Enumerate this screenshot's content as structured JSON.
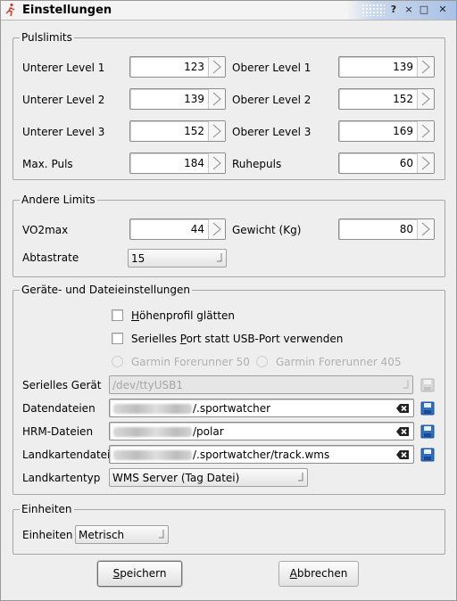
{
  "window": {
    "title": "Einstellungen",
    "buttons": {
      "help": "?",
      "minimize": "×",
      "maximize": "□",
      "close": "✕"
    }
  },
  "pulse_limits": {
    "title": "Pulslimits",
    "rows": [
      {
        "left_label": "Unterer Level 1",
        "left_value": "123",
        "right_label": "Oberer Level 1",
        "right_value": "139"
      },
      {
        "left_label": "Unterer Level 2",
        "left_value": "139",
        "right_label": "Oberer Level 2",
        "right_value": "152"
      },
      {
        "left_label": "Unterer Level 3",
        "left_value": "152",
        "right_label": "Oberer Level 3",
        "right_value": "169"
      },
      {
        "left_label": "Max. Puls",
        "left_value": "184",
        "right_label": "Ruhepuls",
        "right_value": "60"
      }
    ]
  },
  "other_limits": {
    "title": "Andere Limits",
    "vo2max_label": "VO2max",
    "vo2max_value": "44",
    "weight_label": "Gewicht (Kg)",
    "weight_value": "80",
    "sample_rate_label": "Abtastrate",
    "sample_rate_value": "15"
  },
  "device_settings": {
    "title": "Geräte- und Dateieinstellungen",
    "smooth_elevation_pre": "H",
    "smooth_elevation_rest": "öhenprofil glätten",
    "serial_port_pre": "Serielles ",
    "serial_port_key": "P",
    "serial_port_rest": "ort statt USB-Port verwenden",
    "radio_fr50": "Garmin Forerunner 50",
    "radio_fr405": "Garmin Forerunner 405",
    "serial_device_label": "Serielles Gerät",
    "serial_device_value": "/dev/ttyUSB1",
    "data_files_label": "Datendateien",
    "data_files_value": "/.sportwatcher",
    "hrm_files_label": "HRM-Dateien",
    "hrm_files_value": "/polar",
    "map_file_label": "Landkartendatei",
    "map_file_value": "/.sportwatcher/track.wms",
    "map_type_label": "Landkartentyp",
    "map_type_value": "WMS Server (Tag Datei)"
  },
  "units": {
    "title": "Einheiten",
    "label": "Einheiten",
    "value": "Metrisch"
  },
  "actions": {
    "save_key": "S",
    "save_rest": "peichern",
    "cancel_key": "A",
    "cancel_rest": "bbrechen"
  },
  "icons": {
    "app": "runner-icon",
    "spin": "spin-arrows-icon",
    "combo": "dropdown-arrow-icon",
    "clear": "clear-field-icon",
    "save": "floppy-disk-icon"
  },
  "colors": {
    "save_icon": "#2d6fc4",
    "titlebar_accent": "#aac2e6"
  }
}
